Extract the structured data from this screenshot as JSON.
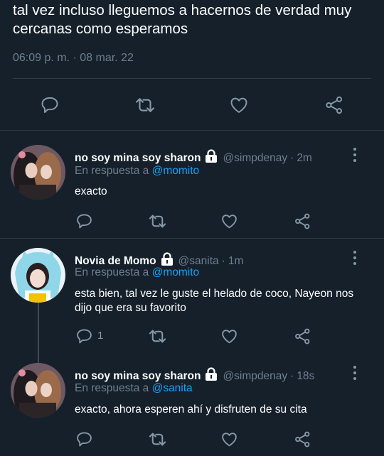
{
  "main_tweet": {
    "text": "tal vez incluso lleguemos a hacernos de verdad muy cercanas como esperamos",
    "timestamp": "06:09 p. m. · 08 mar. 22"
  },
  "replies": [
    {
      "name": "no soy mina soy sharon",
      "handle": "@simpdenay",
      "separator": "·",
      "time": "2m",
      "in_reply_prefix": "En respuesta a",
      "in_reply_to": "@momito",
      "text": "exacto",
      "reply_count": ""
    },
    {
      "name": "Novia de Momo",
      "handle": "@sanita",
      "separator": "·",
      "time": "1m",
      "in_reply_prefix": "En respuesta a",
      "in_reply_to": "@momito",
      "text": "esta bien, tal vez le guste el helado de coco, Nayeon nos dijo que era su favorito",
      "reply_count": "1"
    },
    {
      "name": "no soy mina soy sharon",
      "handle": "@simpdenay",
      "separator": "·",
      "time": "18s",
      "in_reply_prefix": "En respuesta a",
      "in_reply_to": "@sanita",
      "text": "exacto, ahora esperen ahí y disfruten de su cita",
      "reply_count": ""
    }
  ],
  "icons": {
    "reply": "reply-icon",
    "retweet": "retweet-icon",
    "like": "heart-icon",
    "share": "share-icon",
    "lock": "lock-icon",
    "more": "more-vertical-icon"
  },
  "colors": {
    "background": "#15202b",
    "text": "#ffffff",
    "secondary": "#6f7f8e",
    "icon": "#8899a6",
    "mention": "#1da1f2",
    "divider": "#2f3b47"
  }
}
